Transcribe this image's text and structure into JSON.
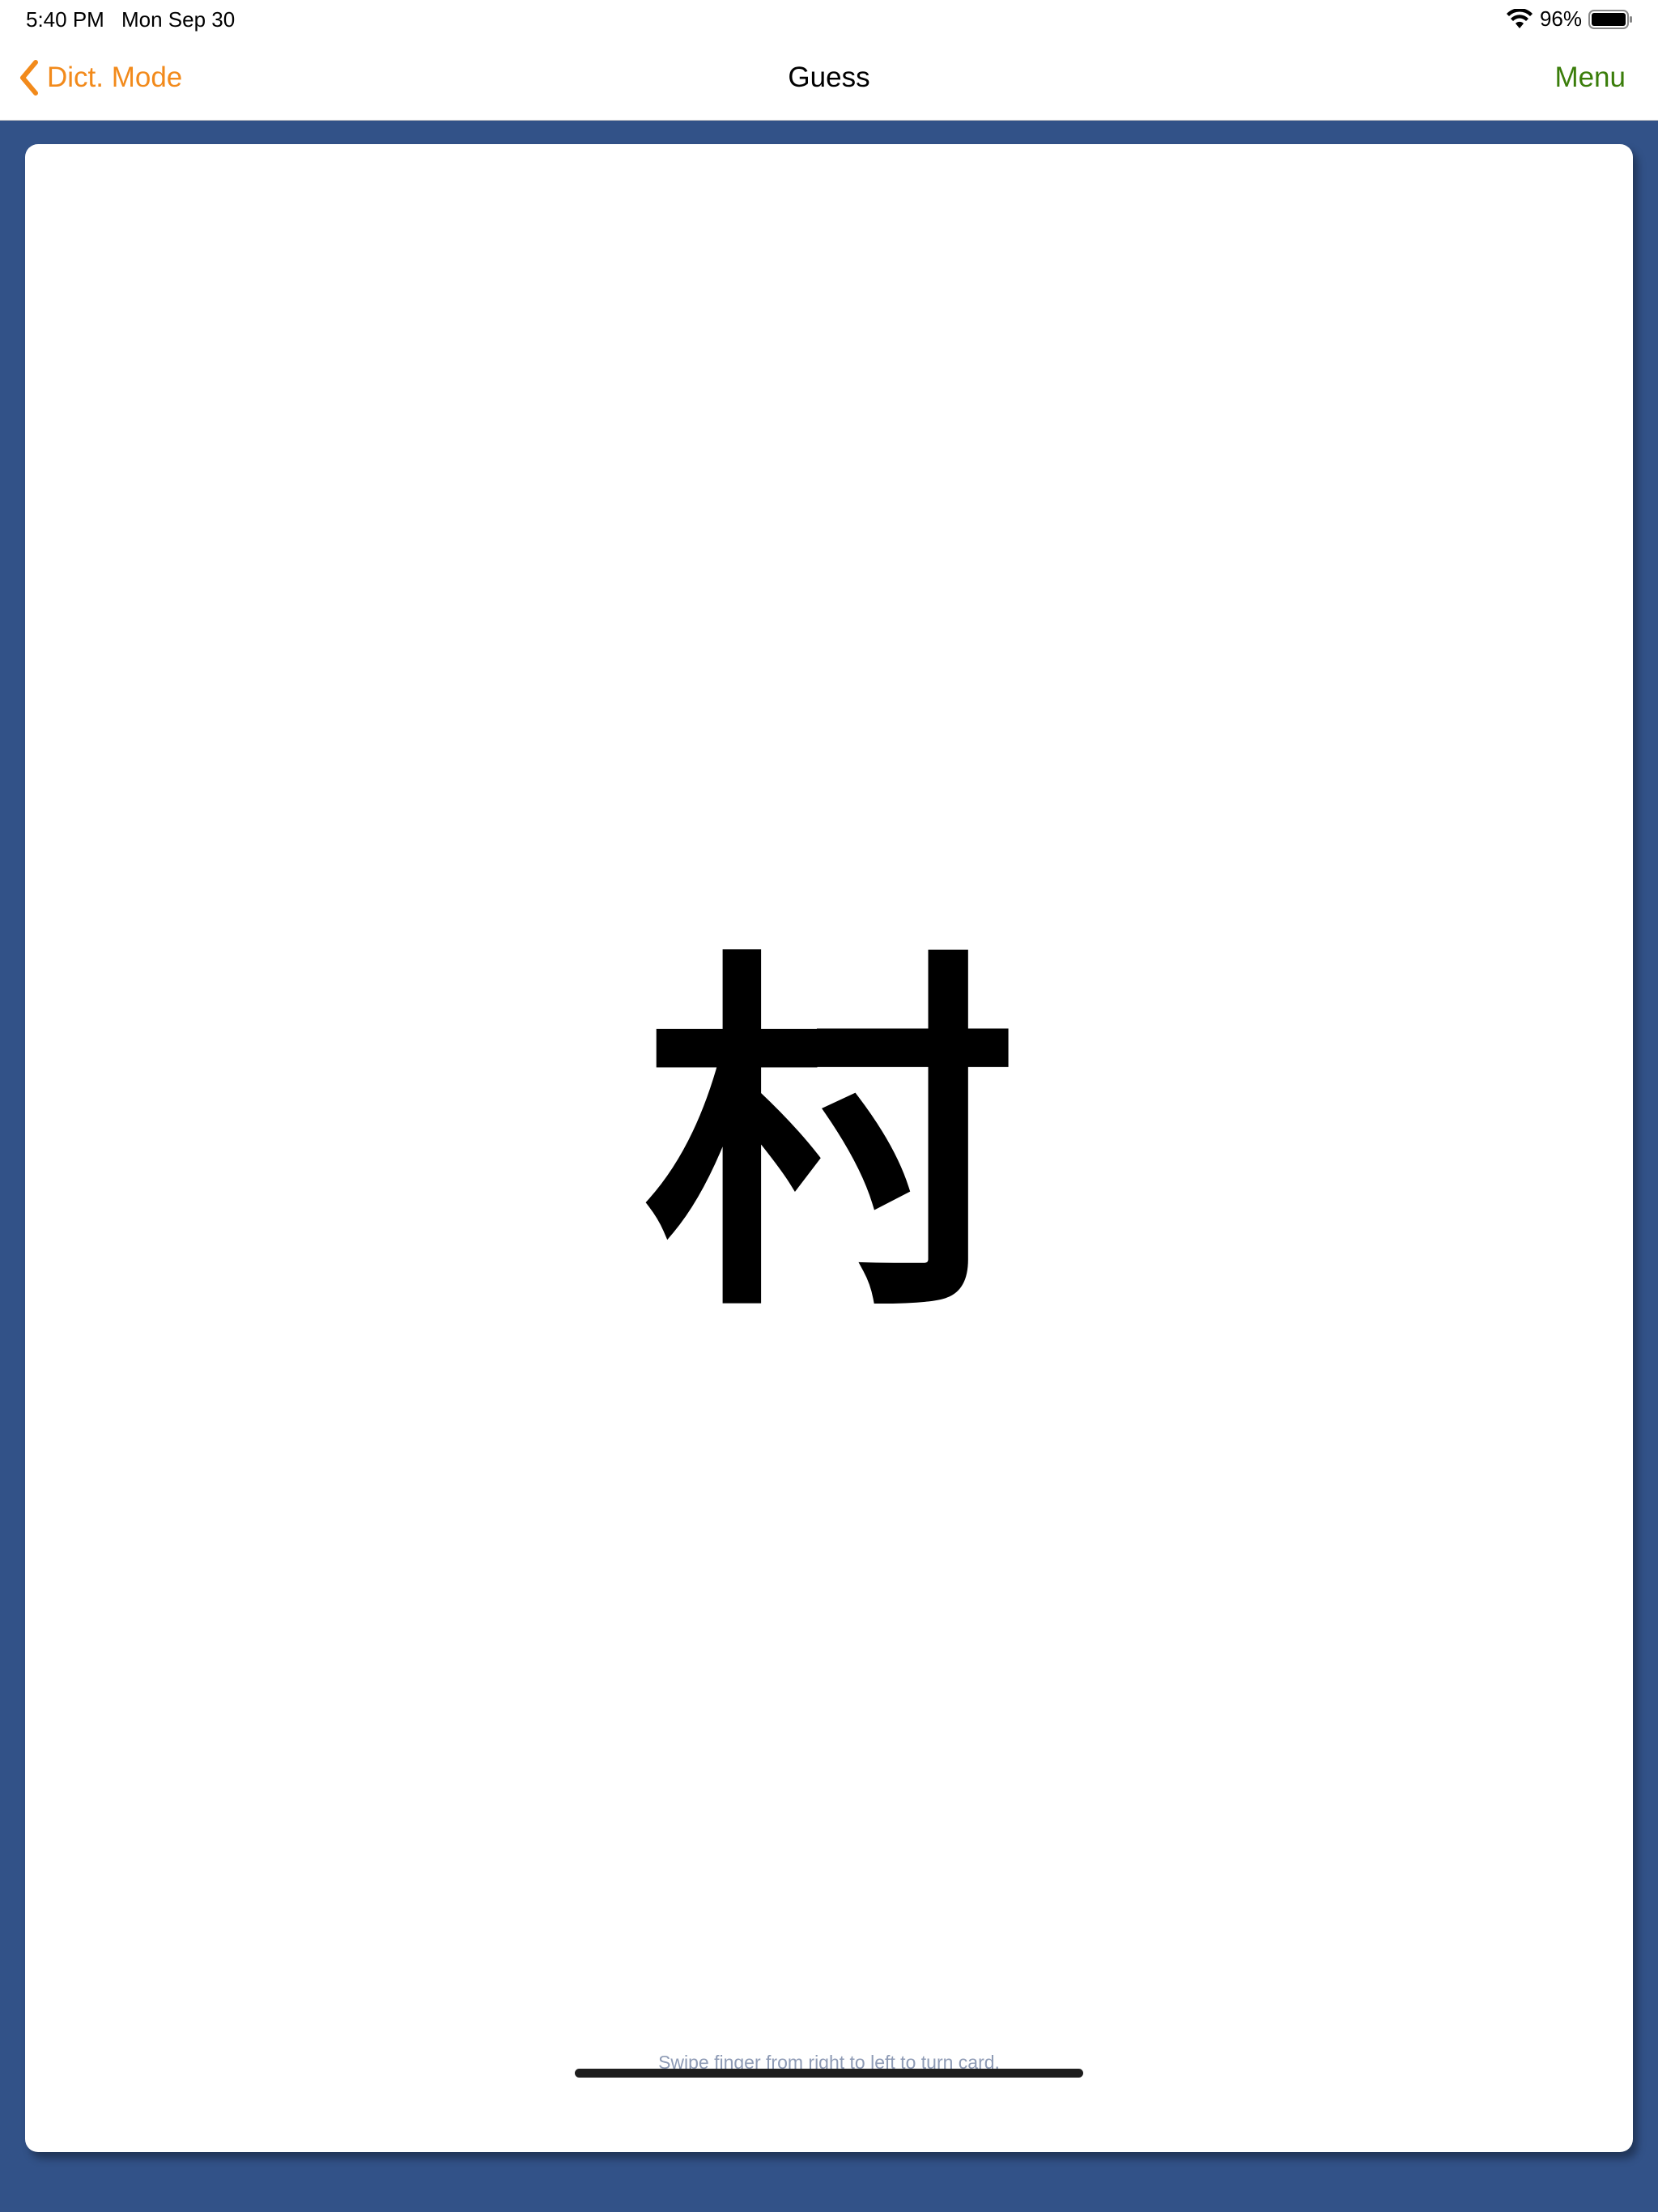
{
  "status_bar": {
    "time": "5:40 PM",
    "date": "Mon Sep 30",
    "battery": "96%",
    "icons": [
      "wifi-icon",
      "battery-icon"
    ]
  },
  "nav": {
    "back_label": "Dict. Mode",
    "title": "Guess",
    "menu_label": "Menu",
    "back_icon": "chevron-left-icon"
  },
  "card": {
    "glyph": "村"
  },
  "hint": "Swipe finger from right to left to turn card.",
  "colors": {
    "accent_orange": "#f28a1b",
    "menu_green": "#3a7d0a",
    "background_blue": "#325288",
    "card_white": "#ffffff"
  }
}
